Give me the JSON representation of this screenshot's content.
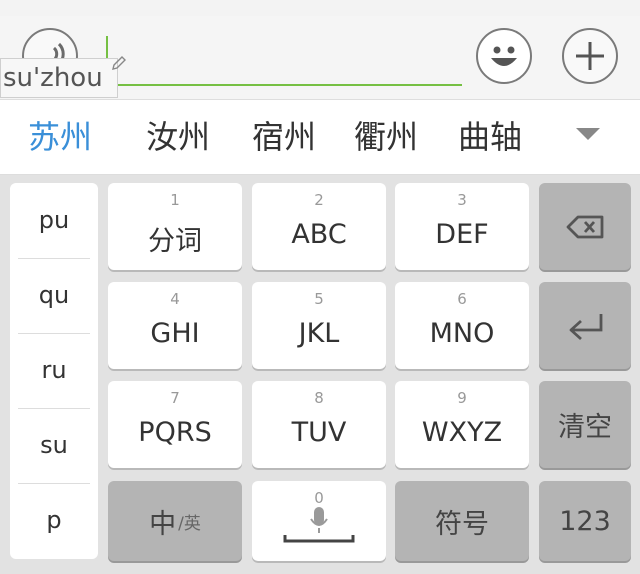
{
  "composition": {
    "text": "su'zhou"
  },
  "candidates": [
    {
      "text": "苏州",
      "active": true
    },
    {
      "text": "汝州",
      "active": false
    },
    {
      "text": "宿州",
      "active": false
    },
    {
      "text": "衢州",
      "active": false
    },
    {
      "text": "曲轴",
      "active": false
    }
  ],
  "pinyin_list": [
    "pu",
    "qu",
    "ru",
    "su",
    "p"
  ],
  "keys": {
    "k1": {
      "num": "1",
      "label": "分词"
    },
    "k2": {
      "num": "2",
      "label": "ABC"
    },
    "k3": {
      "num": "3",
      "label": "DEF"
    },
    "k4": {
      "num": "4",
      "label": "GHI"
    },
    "k5": {
      "num": "5",
      "label": "JKL"
    },
    "k6": {
      "num": "6",
      "label": "MNO"
    },
    "k7": {
      "num": "7",
      "label": "PQRS"
    },
    "k8": {
      "num": "8",
      "label": "TUV"
    },
    "k9": {
      "num": "9",
      "label": "WXYZ"
    },
    "k0": {
      "num": "0"
    },
    "lang_main": "中",
    "lang_sub": "/英",
    "symbols": "符号",
    "numbers": "123",
    "clear": "清空"
  },
  "colors": {
    "accent_green": "#76c043",
    "candidate_active": "#3a8fd8",
    "function_key": "#b4b4b4"
  },
  "icons": [
    "voice-icon",
    "emoji-icon",
    "plus-icon",
    "pencil-icon",
    "dropdown-arrow-icon",
    "backspace-icon",
    "enter-icon",
    "microphone-icon"
  ]
}
